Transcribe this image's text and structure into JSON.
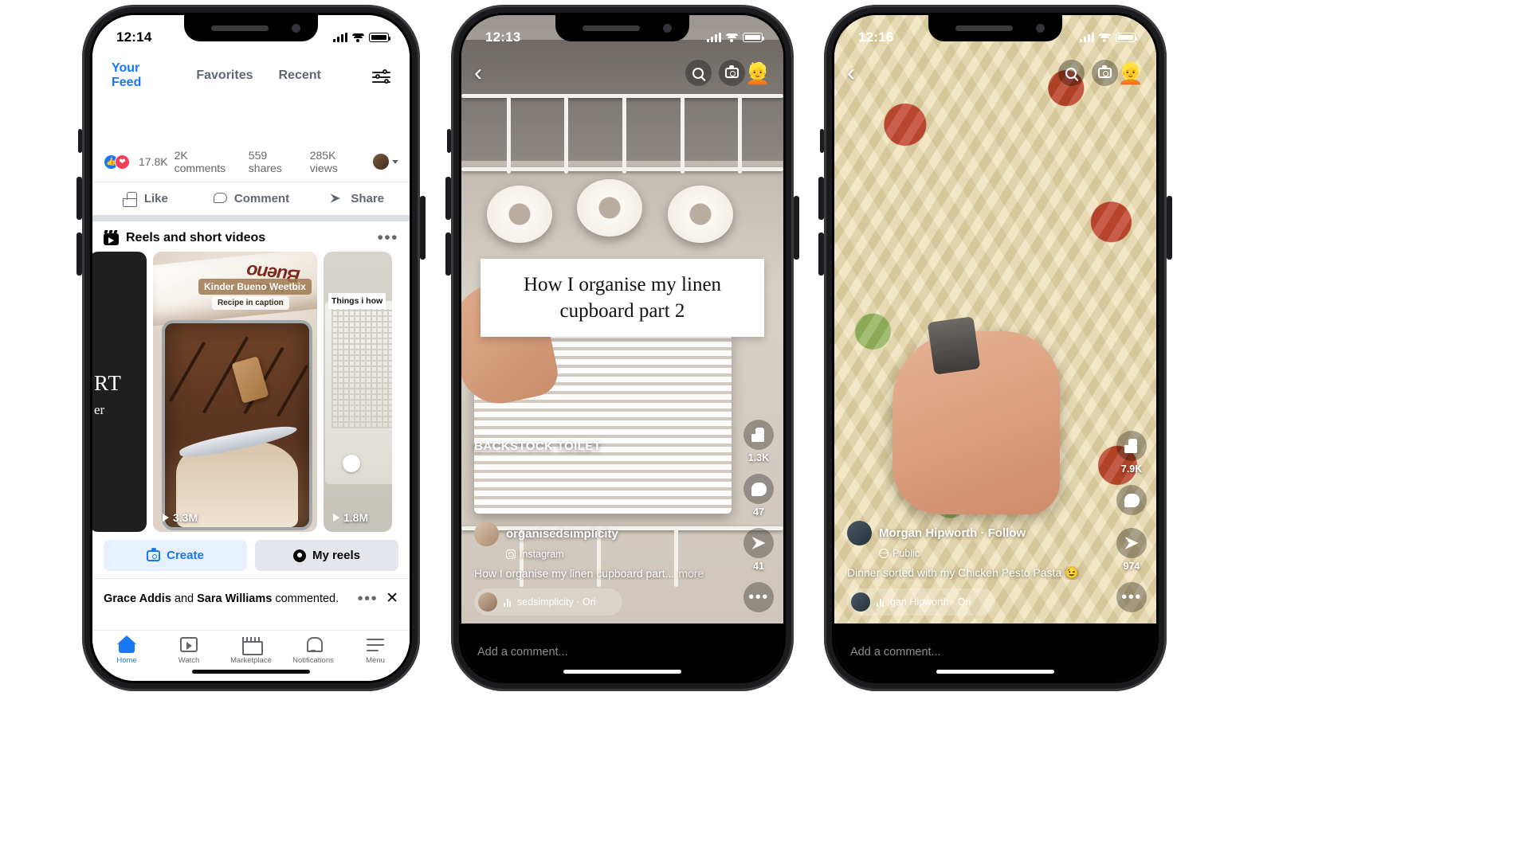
{
  "phone1": {
    "status": {
      "time": "12:14"
    },
    "tabs": [
      {
        "label": "Your Feed",
        "active": true
      },
      {
        "label": "Favorites",
        "active": false
      },
      {
        "label": "Recent",
        "active": false
      }
    ],
    "filter_icon": "sliders-icon",
    "post": {
      "reaction_count": "17.8K",
      "comments": "2K comments",
      "shares": "559 shares",
      "views": "285K views",
      "actions": [
        {
          "label": "Like",
          "icon": "thumbs-up-icon"
        },
        {
          "label": "Comment",
          "icon": "comment-bubble-icon"
        },
        {
          "label": "Share",
          "icon": "share-arrow-icon"
        }
      ]
    },
    "reels_section": {
      "title": "Reels and short videos",
      "icon": "reels-clapperboard-icon",
      "overflow": "•••",
      "cards": [
        {
          "overlay_line1": "RT",
          "overlay_line2": "er",
          "views": ""
        },
        {
          "tag_title": "Kinder Bueno Weetbix",
          "tag_sub": "Recipe in caption",
          "views": "3.3M"
        },
        {
          "overlay_text": "Things i\nhow",
          "views": "1.8M"
        }
      ],
      "buttons": [
        {
          "label": "Create",
          "icon": "camera-icon"
        },
        {
          "label": "My reels",
          "icon": "user-circle-icon"
        }
      ]
    },
    "notice": {
      "name1": "Grace Addis",
      "middle": " and ",
      "name2": "Sara Williams",
      "tail": " commented.",
      "overflow": "•••",
      "close": "✕"
    },
    "nav": [
      {
        "label": "Home",
        "icon": "home-icon",
        "active": true
      },
      {
        "label": "Watch",
        "icon": "watch-video-icon",
        "active": false
      },
      {
        "label": "Marketplace",
        "icon": "marketplace-store-icon",
        "active": false
      },
      {
        "label": "Notifications",
        "icon": "bell-icon",
        "active": false
      },
      {
        "label": "Menu",
        "icon": "hamburger-menu-icon",
        "active": false
      }
    ]
  },
  "phone2": {
    "status": {
      "time": "12:13"
    },
    "top": {
      "back": "‹",
      "search_icon": "search-icon",
      "camera_icon": "camera-icon",
      "avatar": "👱"
    },
    "overlay_title": "How I organise my linen\ncupboard part 2",
    "overlay_label": "BACKSTOCK TOILET",
    "author": {
      "name": "organisedsimplicity",
      "source": "Instagram",
      "source_icon": "instagram-icon"
    },
    "caption": "How I organise my linen cupboard part...",
    "caption_more": "more",
    "audio": "sedsimplicity · Ori",
    "rail": [
      {
        "icon": "thumbs-up-icon",
        "count": "1.3K"
      },
      {
        "icon": "comment-bubble-icon",
        "count": "47"
      },
      {
        "icon": "share-arrow-icon",
        "count": "41"
      },
      {
        "icon": "more-options-icon",
        "count": ""
      }
    ],
    "comment_placeholder": "Add a comment..."
  },
  "phone3": {
    "status": {
      "time": "12:16"
    },
    "top": {
      "back": "‹",
      "search_icon": "search-icon",
      "camera_icon": "camera-icon",
      "avatar": "👱"
    },
    "author": {
      "name": "Morgan Hipworth · Follow",
      "privacy": "Public",
      "privacy_icon": "globe-icon"
    },
    "caption": "Dinner sorted with my Chicken Pesto Pasta 😉",
    "audio": "gan Hipworth · Ori",
    "rail": [
      {
        "icon": "thumbs-up-icon",
        "count": "7.9K"
      },
      {
        "icon": "comment-bubble-icon",
        "count": ""
      },
      {
        "icon": "share-arrow-icon",
        "count": "974"
      },
      {
        "icon": "more-options-icon",
        "count": ""
      }
    ],
    "comment_placeholder": "Add a comment..."
  }
}
